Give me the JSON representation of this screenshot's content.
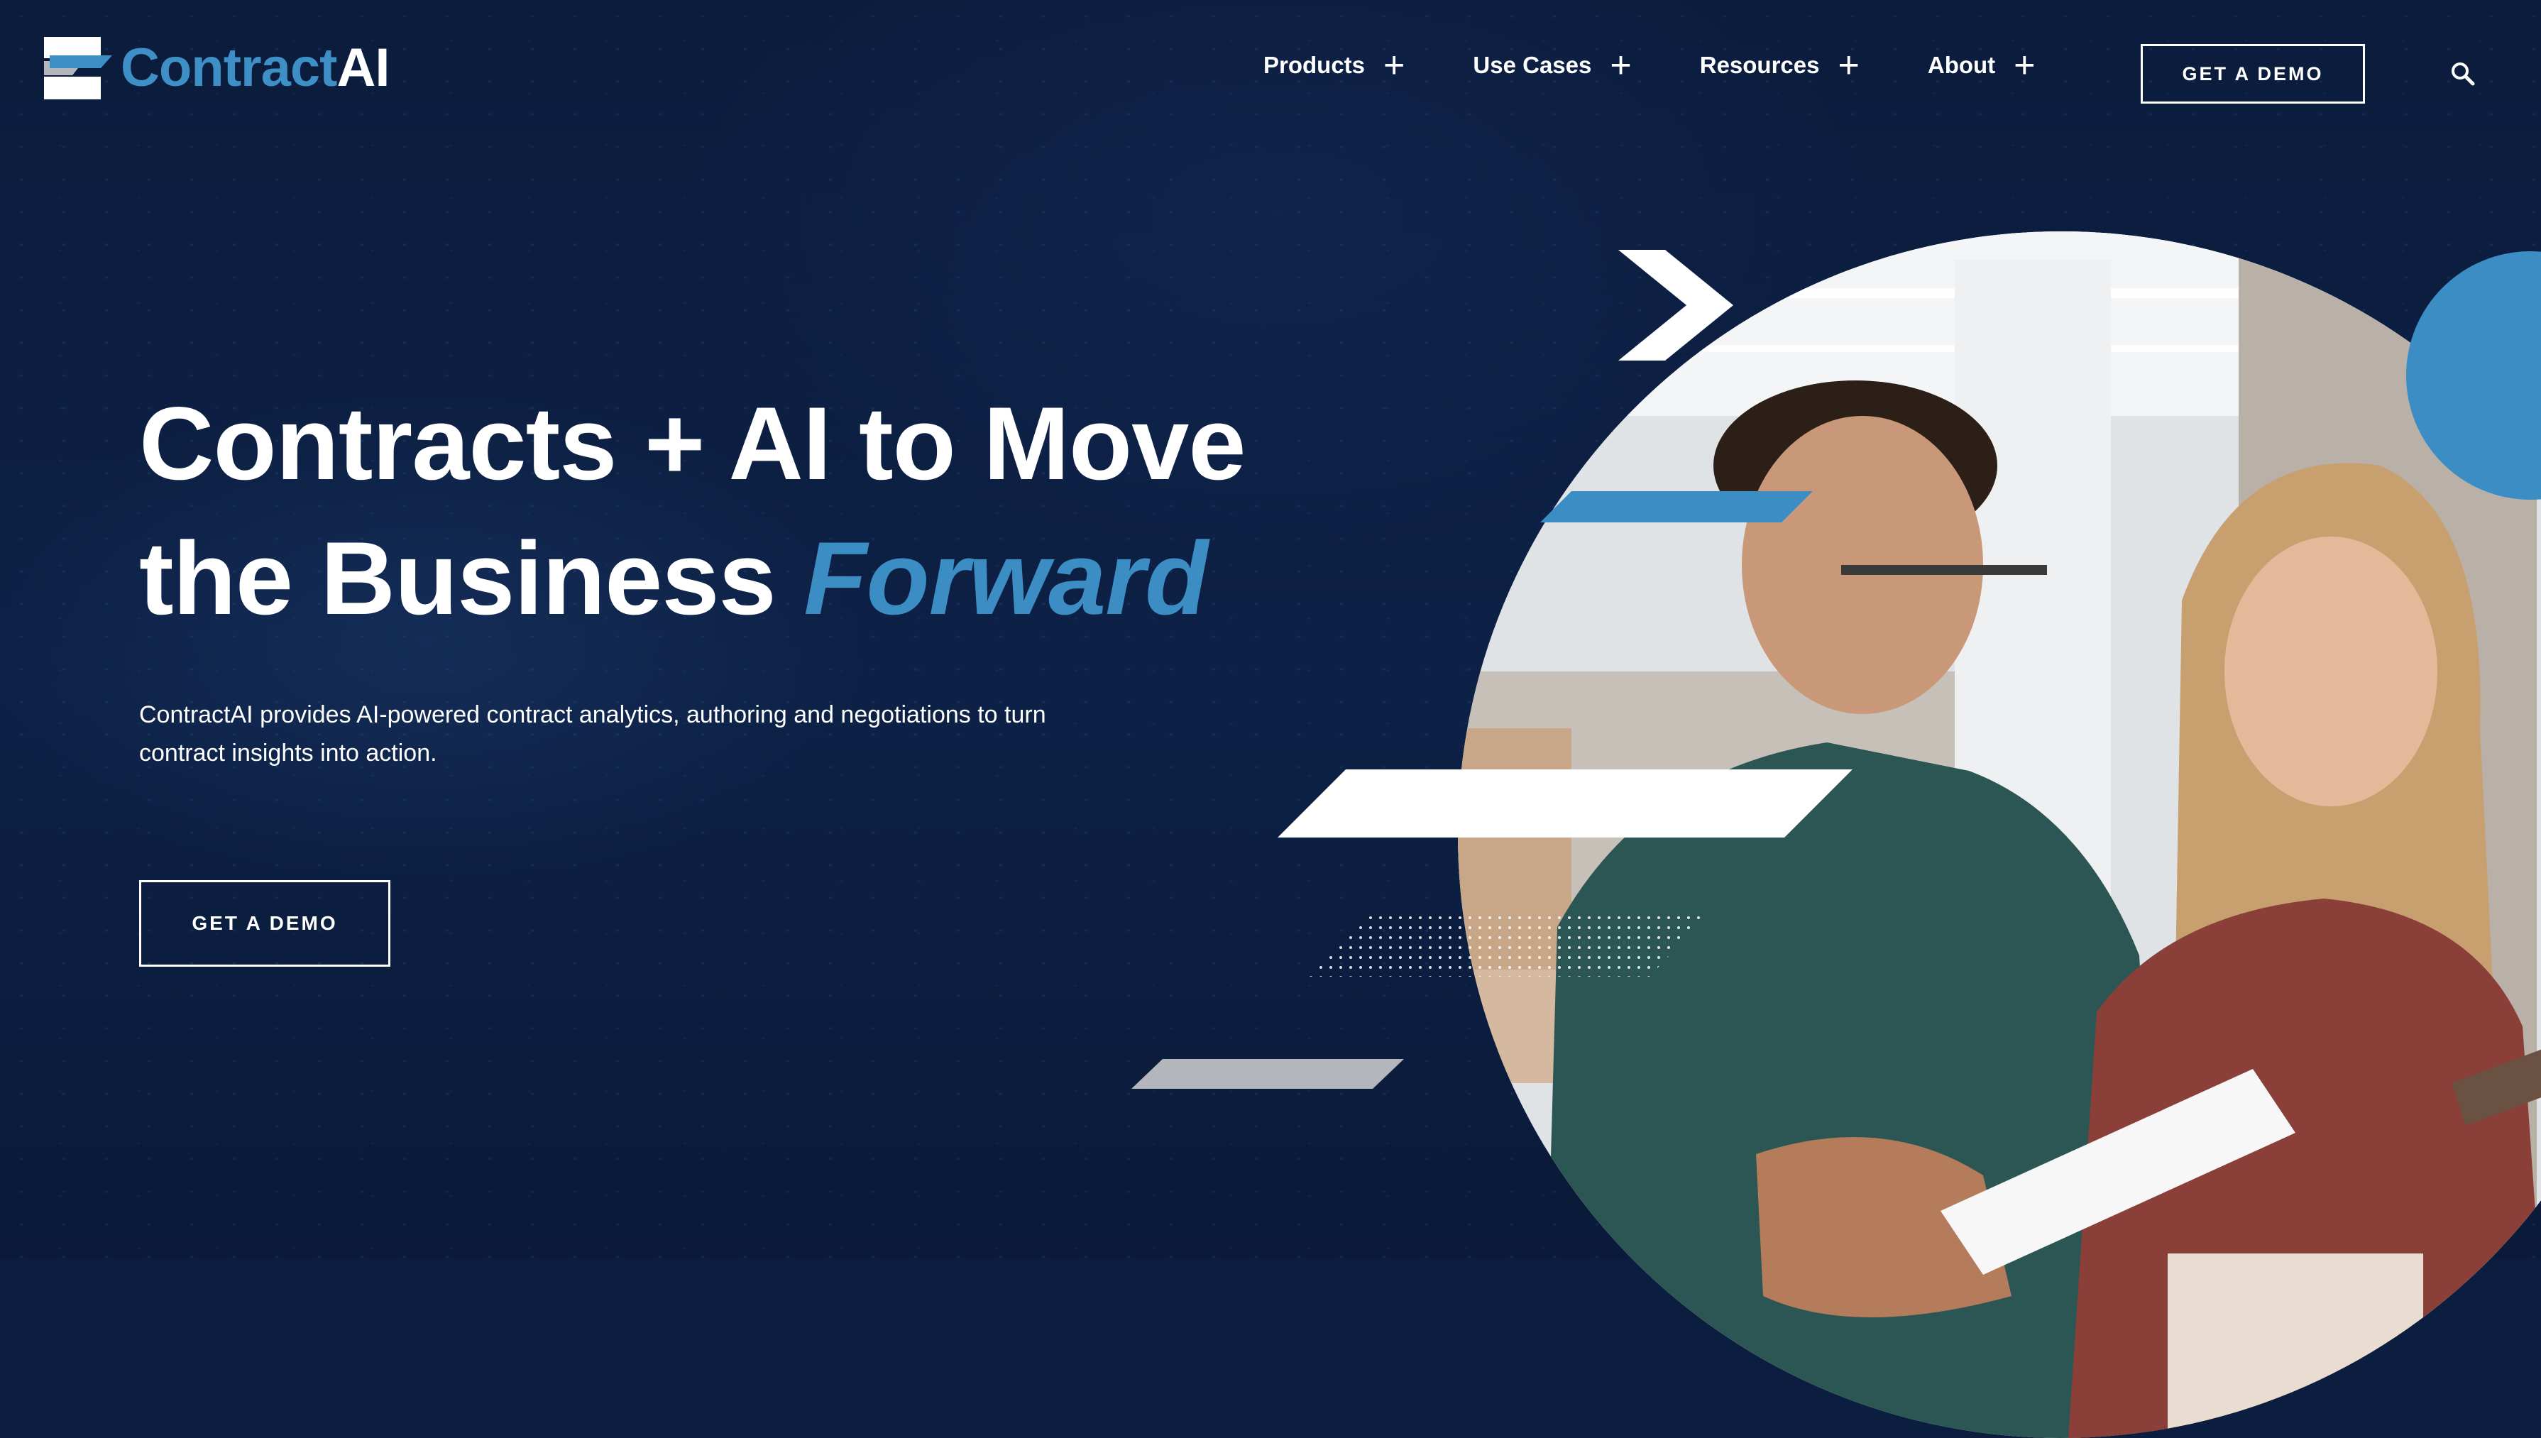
{
  "brand": {
    "name_part1": "Contract",
    "name_part2": "AI"
  },
  "nav": {
    "items": [
      {
        "label": "Products"
      },
      {
        "label": "Use Cases"
      },
      {
        "label": "Resources"
      },
      {
        "label": "About"
      }
    ],
    "cta_label": "GET A DEMO"
  },
  "hero": {
    "headline_line1": "Contracts + AI to Move",
    "headline_line2_prefix": "the Business ",
    "headline_accent": "Forward",
    "subtext": "ContractAI provides AI-powered contract analytics, authoring and negotiations to turn contract insights into action.",
    "cta_label": "GET A DEMO"
  },
  "icons": {
    "logo": "contractai-logo-icon",
    "nav_expand": "plus-icon",
    "search": "search-icon"
  },
  "colors": {
    "background": "#0c1e3f",
    "accent": "#3b8dc4",
    "text": "#ffffff",
    "decor_gray": "#b3b6ba"
  }
}
